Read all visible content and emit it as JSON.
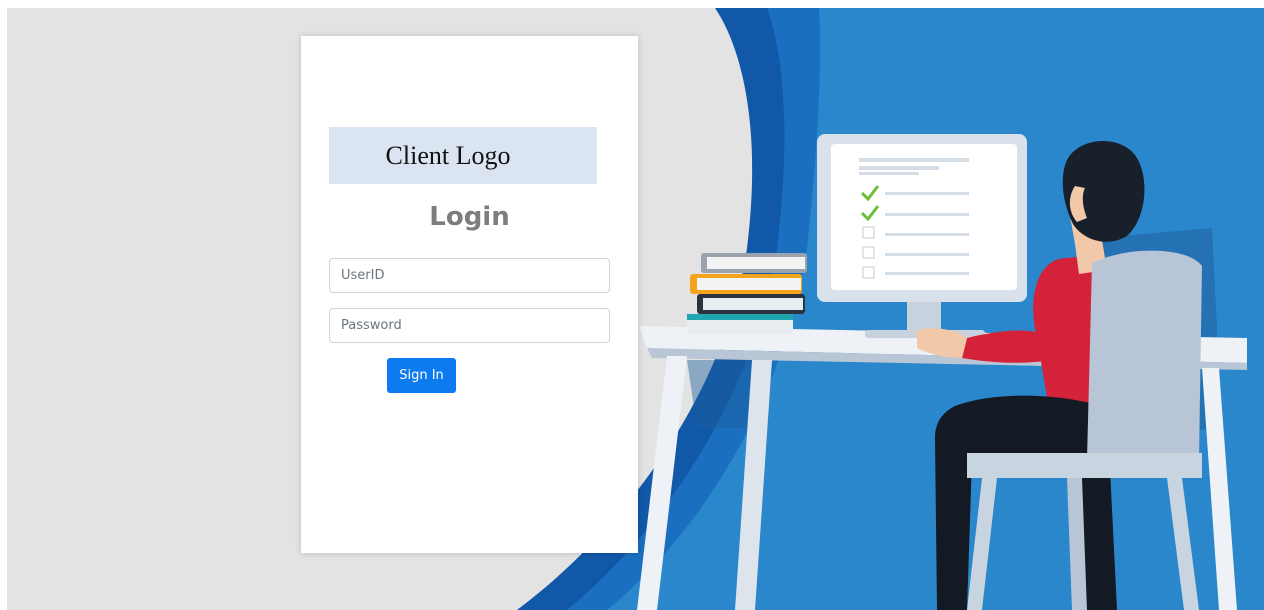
{
  "login": {
    "logo_text": "Client Logo",
    "title": "Login",
    "userid_placeholder": "UserID",
    "password_placeholder": "Password",
    "signin_label": "Sign In"
  },
  "illustration": {
    "subject": "person-at-computer-desk",
    "checklist_checked": 2,
    "checklist_total": 5
  },
  "colors": {
    "page_bg": "#e3e3e3",
    "illustration_blue": "#2a87cc",
    "deep_blue": "#1158a8",
    "button_blue": "#0d7bf0",
    "logo_bg": "#dbe5f1",
    "title_gray": "#7d7d7d",
    "shirt_red": "#d4223b",
    "check_green": "#6bbf3a"
  }
}
